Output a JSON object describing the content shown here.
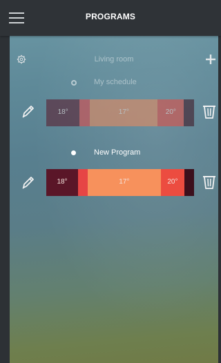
{
  "header": {
    "title": "PROGRAMS"
  },
  "room": {
    "name": "Living room"
  },
  "programs": [
    {
      "name": "My schedule",
      "active": false,
      "segments": [
        {
          "label": "18°",
          "color": "#5a1628",
          "fraction": 0.226
        },
        {
          "label": "",
          "color": "#e64545",
          "fraction": 0.07
        },
        {
          "label": "17°",
          "color": "#f28a5a",
          "fraction": 0.458
        },
        {
          "label": "20°",
          "color": "#e94a3f",
          "fraction": 0.178
        },
        {
          "label": "",
          "color": "#3c0f1c",
          "fraction": 0.068
        }
      ]
    },
    {
      "name": "New Program",
      "active": true,
      "segments": [
        {
          "label": "18°",
          "color": "#5a1628",
          "fraction": 0.215
        },
        {
          "label": "",
          "color": "#e64545",
          "fraction": 0.065
        },
        {
          "label": "17°",
          "color": "#f7915c",
          "fraction": 0.495
        },
        {
          "label": "20°",
          "color": "#ec4c40",
          "fraction": 0.16
        },
        {
          "label": "",
          "color": "#3c0f1c",
          "fraction": 0.065
        }
      ]
    }
  ],
  "icons": {
    "menu": "hamburger-menu-icon",
    "settings": "gear-icon",
    "add": "plus-icon",
    "edit": "pencil-icon",
    "delete": "trash-icon"
  },
  "colors": {
    "topbar": "#2f3337",
    "warm": "#f7915c",
    "hot": "#ec4c40",
    "cold": "#5a1628"
  }
}
